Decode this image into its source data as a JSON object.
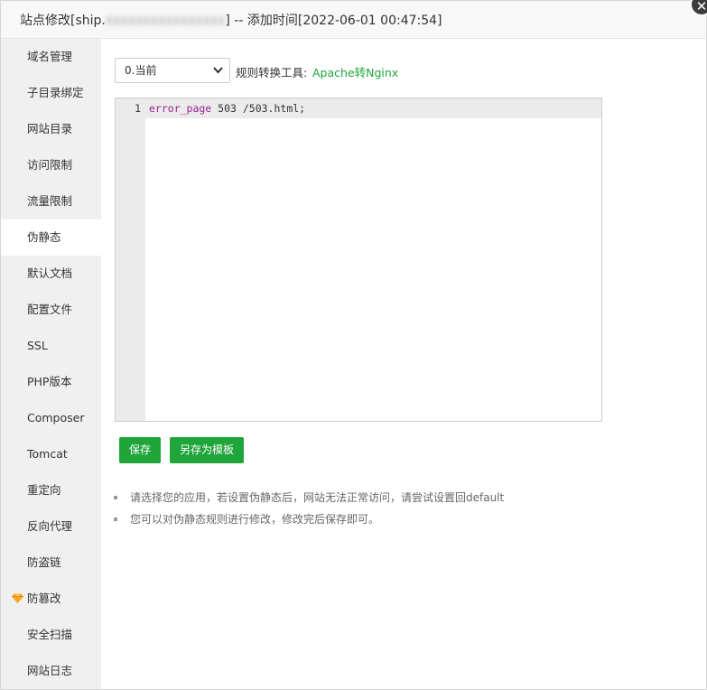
{
  "dialog": {
    "title_prefix": "站点修改[ship.",
    "title_blurred": "xxxxxxxxxxxxxxxx",
    "title_suffix": "] -- 添加时间[2022-06-01 00:47:54]",
    "close_glyph": "✕"
  },
  "sidebar": {
    "items": [
      {
        "label": "域名管理"
      },
      {
        "label": "子目录绑定"
      },
      {
        "label": "网站目录"
      },
      {
        "label": "访问限制"
      },
      {
        "label": "流量限制"
      },
      {
        "label": "伪静态"
      },
      {
        "label": "默认文档"
      },
      {
        "label": "配置文件"
      },
      {
        "label": "SSL"
      },
      {
        "label": "PHP版本"
      },
      {
        "label": "Composer"
      },
      {
        "label": "Tomcat"
      },
      {
        "label": "重定向"
      },
      {
        "label": "反向代理"
      },
      {
        "label": "防盗链"
      },
      {
        "label": "防篡改",
        "icon": "gem-icon"
      },
      {
        "label": "安全扫描"
      },
      {
        "label": "网站日志"
      }
    ],
    "active_index": 5
  },
  "rewrite": {
    "select_value": "0.当前",
    "tool_label": "规则转换工具:",
    "tool_link": "Apache转Nginx",
    "editor": {
      "line_number": "1",
      "code_keyword": "error_page",
      "code_rest": " 503 /503.html;"
    },
    "save_button": "保存",
    "save_as_button": "另存为模板",
    "tips": [
      "请选择您的应用，若设置伪静态后，网站无法正常访问，请尝试设置回default",
      "您可以对伪静态规则进行修改，修改完后保存即可。"
    ]
  },
  "colors": {
    "accent": "#20a53a",
    "sidebar_bg": "#f0f0f0",
    "gem": "#f5a623"
  }
}
